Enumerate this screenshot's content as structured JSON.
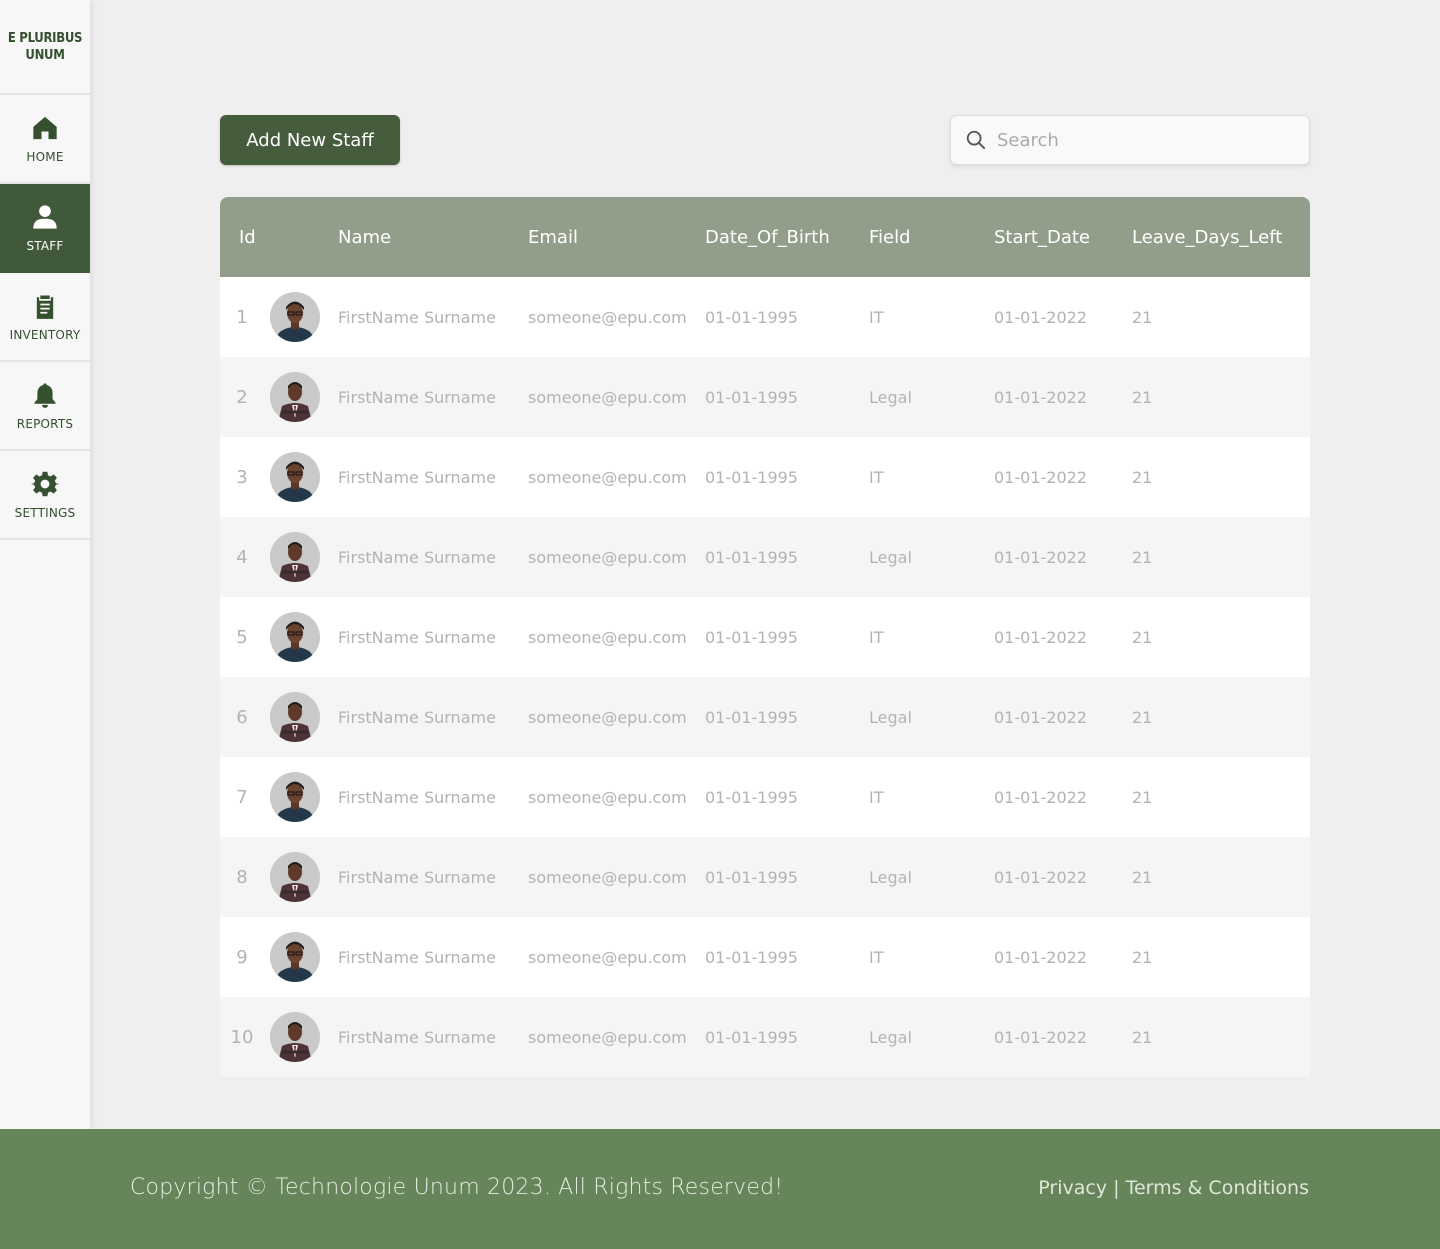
{
  "brand": {
    "logo_text": "E PLURIBUS UNUM"
  },
  "sidebar": {
    "items": [
      {
        "label": "HOME",
        "icon": "home-icon"
      },
      {
        "label": "STAFF",
        "icon": "person-icon",
        "active": true
      },
      {
        "label": "INVENTORY",
        "icon": "clipboard-icon"
      },
      {
        "label": "REPORTS",
        "icon": "bell-icon"
      },
      {
        "label": "SETTINGS",
        "icon": "gear-icon"
      }
    ]
  },
  "toolbar": {
    "add_label": "Add New Staff",
    "search_placeholder": "Search"
  },
  "table": {
    "headers": [
      "Id",
      "Name",
      "Email",
      "Date_Of_Birth",
      "Field",
      "Start_Date",
      "Leave_Days_Left"
    ],
    "rows": [
      {
        "id": "1",
        "name": "FirstName Surname",
        "email": "someone@epu.com",
        "dob": "01-01-1995",
        "field": "IT",
        "start": "01-01-2022",
        "leave": "21"
      },
      {
        "id": "2",
        "name": "FirstName Surname",
        "email": "someone@epu.com",
        "dob": "01-01-1995",
        "field": "Legal",
        "start": "01-01-2022",
        "leave": "21"
      },
      {
        "id": "3",
        "name": "FirstName Surname",
        "email": "someone@epu.com",
        "dob": "01-01-1995",
        "field": "IT",
        "start": "01-01-2022",
        "leave": "21"
      },
      {
        "id": "4",
        "name": "FirstName Surname",
        "email": "someone@epu.com",
        "dob": "01-01-1995",
        "field": "Legal",
        "start": "01-01-2022",
        "leave": "21"
      },
      {
        "id": "5",
        "name": "FirstName Surname",
        "email": "someone@epu.com",
        "dob": "01-01-1995",
        "field": "IT",
        "start": "01-01-2022",
        "leave": "21"
      },
      {
        "id": "6",
        "name": "FirstName Surname",
        "email": "someone@epu.com",
        "dob": "01-01-1995",
        "field": "Legal",
        "start": "01-01-2022",
        "leave": "21"
      },
      {
        "id": "7",
        "name": "FirstName Surname",
        "email": "someone@epu.com",
        "dob": "01-01-1995",
        "field": "IT",
        "start": "01-01-2022",
        "leave": "21"
      },
      {
        "id": "8",
        "name": "FirstName Surname",
        "email": "someone@epu.com",
        "dob": "01-01-1995",
        "field": "Legal",
        "start": "01-01-2022",
        "leave": "21"
      },
      {
        "id": "9",
        "name": "FirstName Surname",
        "email": "someone@epu.com",
        "dob": "01-01-1995",
        "field": "IT",
        "start": "01-01-2022",
        "leave": "21"
      },
      {
        "id": "10",
        "name": "FirstName Surname",
        "email": "someone@epu.com",
        "dob": "01-01-1995",
        "field": "Legal",
        "start": "01-01-2022",
        "leave": "21"
      }
    ]
  },
  "footer": {
    "copyright": "Copyright © Technologie Unum 2023. All Rights Reserved!",
    "privacy": "Privacy",
    "separator": "|",
    "terms": "Terms & Conditions"
  },
  "colors": {
    "primary": "#455c3d",
    "sidebar_active": "#3f593a",
    "table_header": "#939e8a",
    "footer": "#66855a",
    "background": "#efefef"
  }
}
